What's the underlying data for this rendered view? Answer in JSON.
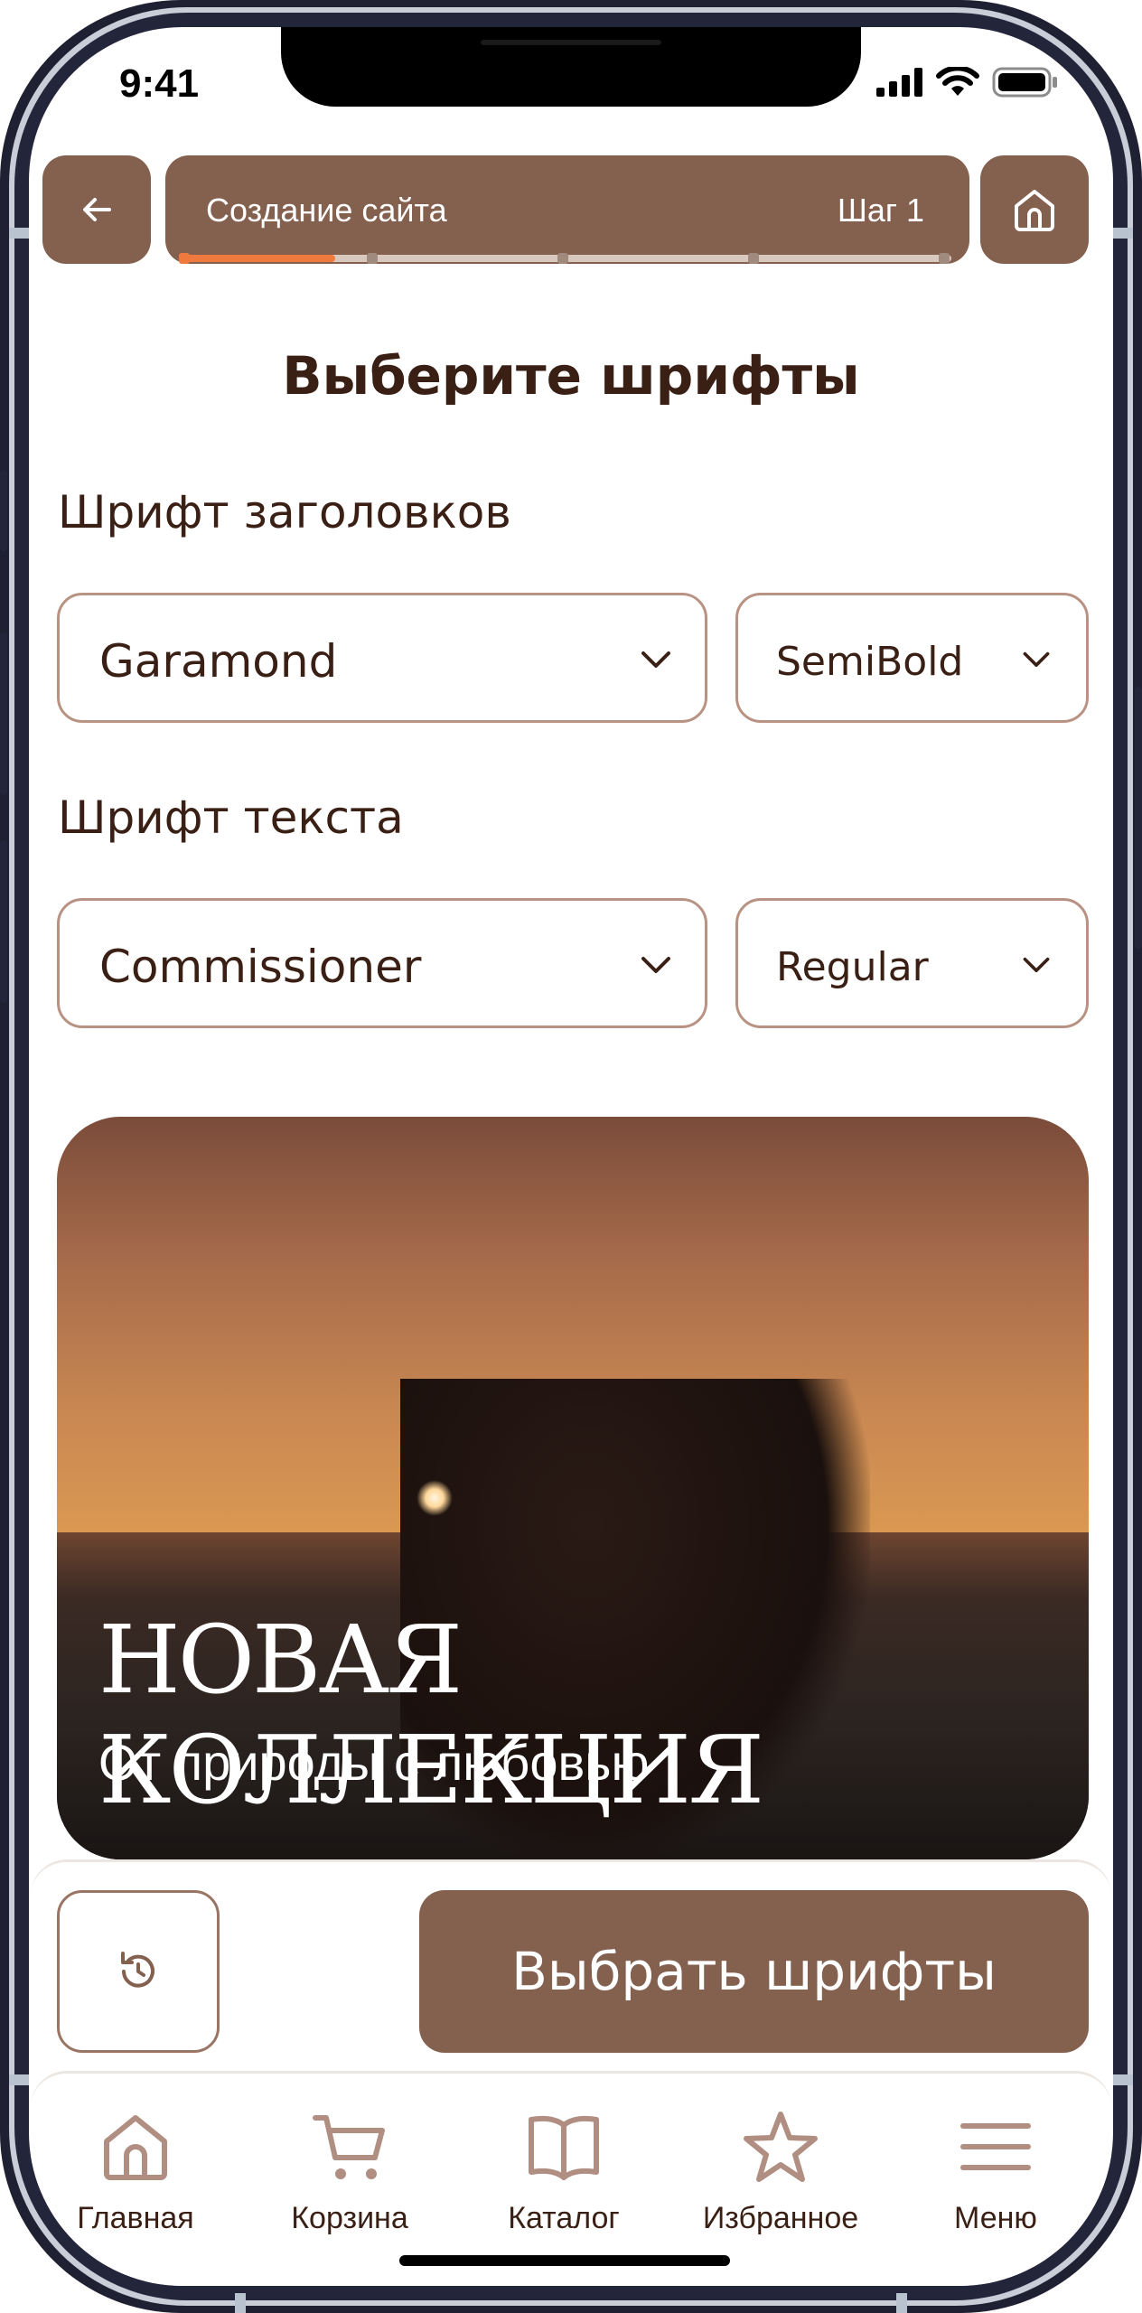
{
  "status_bar": {
    "time": "9:41"
  },
  "header": {
    "title": "Создание сайта",
    "step": "Шаг 1",
    "progress": {
      "current_step": 1,
      "total_steps": 5
    }
  },
  "page": {
    "heading": "Выберите шрифты"
  },
  "headings_font": {
    "label": "Шрифт заголовков",
    "family": "Garamond",
    "weight": "SemiBold"
  },
  "text_font": {
    "label": "Шрифт текста",
    "family": "Commissioner",
    "weight": "Regular"
  },
  "preview": {
    "title": "НОВАЯ КОЛЛЕКЦИЯ",
    "subtitle": "От природы с любовью"
  },
  "actions": {
    "primary_label": "Выбрать шрифты"
  },
  "tabbar": {
    "items": [
      {
        "label": "Главная",
        "icon": "home-icon"
      },
      {
        "label": "Корзина",
        "icon": "cart-icon"
      },
      {
        "label": "Каталог",
        "icon": "book-icon"
      },
      {
        "label": "Избранное",
        "icon": "star-icon"
      },
      {
        "label": "Меню",
        "icon": "menu-icon"
      }
    ]
  },
  "colors": {
    "accent": "#84604f",
    "text": "#3a1f14",
    "progress": "#f07a3e",
    "border": "#b89384"
  }
}
